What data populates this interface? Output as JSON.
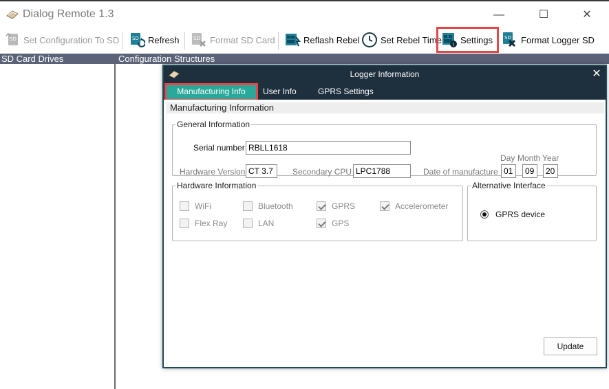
{
  "window": {
    "title": "Dialog Remote 1.3",
    "controls": {
      "minimize": "—",
      "maximize": "☐",
      "close": "✕"
    }
  },
  "toolbar": {
    "buttons": [
      {
        "label": "Set Configuration To SD",
        "icon": "sd-upload-icon",
        "enabled": false
      },
      {
        "label": "Refresh",
        "icon": "sd-refresh-icon",
        "enabled": true
      },
      {
        "label": "Format SD Card",
        "icon": "sd-format-icon",
        "enabled": false
      },
      {
        "label": "Reflash Rebel",
        "icon": "reflash-icon",
        "enabled": true
      },
      {
        "label": "Set Rebel Time",
        "icon": "clock-icon",
        "enabled": true
      },
      {
        "label": "Settings",
        "icon": "settings-icon",
        "enabled": true,
        "highlighted": true
      },
      {
        "label": "Format Logger SD",
        "icon": "sd-format-logger-icon",
        "enabled": true
      }
    ]
  },
  "panels": {
    "left_header": "SD Card Drives",
    "right_header": "Configuration Structures"
  },
  "dialog": {
    "title": "Logger Information",
    "close": "✕",
    "tabs": [
      {
        "label": "Manufacturing Info",
        "active": true,
        "highlighted": true
      },
      {
        "label": "User Info",
        "active": false
      },
      {
        "label": "GPRS Settings",
        "active": false
      }
    ],
    "section_title": "Manufacturing Information",
    "general_information": {
      "legend": "General Information",
      "serial_label": "Serial number",
      "serial_value": "RBLL1618",
      "hw_version_label": "Hardware Version",
      "hw_version_value": "CT 3.7",
      "secondary_cpu_label": "Secondary CPU",
      "secondary_cpu_value": "LPC1788",
      "date_label": "Date of manufacture",
      "date_headers": {
        "day": "Day",
        "month": "Month",
        "year": "Year"
      },
      "date_values": {
        "day": "01",
        "month": "09",
        "year": "20"
      }
    },
    "hardware_information": {
      "legend": "Hardware Information",
      "items": [
        {
          "label": "WiFi",
          "checked": false
        },
        {
          "label": "Bluetooth",
          "checked": false
        },
        {
          "label": "GPRS",
          "checked": true
        },
        {
          "label": "Accelerometer",
          "checked": true
        },
        {
          "label": "Flex Ray",
          "checked": false
        },
        {
          "label": "LAN",
          "checked": false
        },
        {
          "label": "GPS",
          "checked": true
        }
      ]
    },
    "alternative_interface": {
      "legend": "Alternative Interface",
      "option": "GPRS device",
      "selected": true
    },
    "update_label": "Update"
  },
  "colors": {
    "panel_header": "#5c6378",
    "dialog_titlebar": "#1e2f3d",
    "active_tab": "#2aa89a",
    "highlight": "#e74646"
  }
}
